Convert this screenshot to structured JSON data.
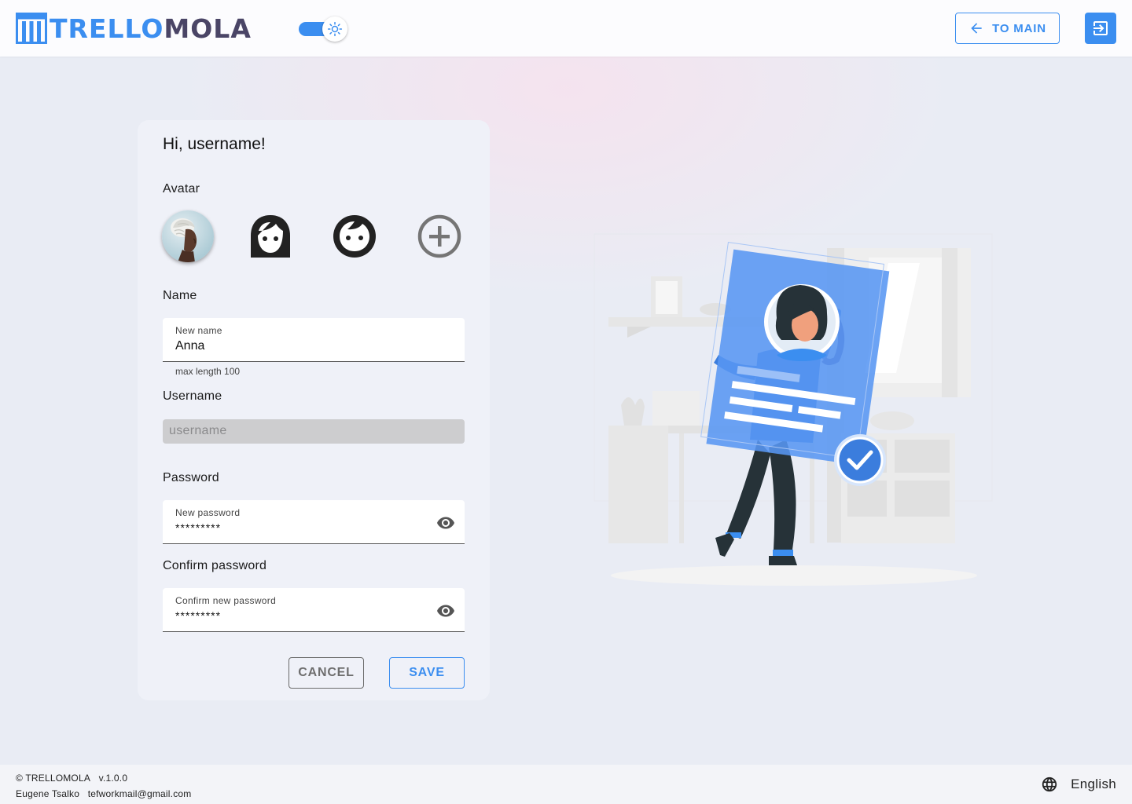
{
  "header": {
    "logo_text_blue": "TRELLO",
    "logo_text_dark": "MOLA",
    "to_main_label": "TO MAIN",
    "theme_icon": "sun-icon",
    "logout_icon": "logout-icon"
  },
  "profile": {
    "greeting": "Hi, username!",
    "avatar_label": "Avatar",
    "avatars": [
      "photo-avatar",
      "female-face-icon",
      "male-face-icon",
      "add-circle-icon"
    ],
    "name_label": "Name",
    "name_field": {
      "label": "New name",
      "value": "Anna",
      "helper": "max length 100"
    },
    "username_label": "Username",
    "username_field": {
      "placeholder": "username"
    },
    "password_label": "Password",
    "password_field": {
      "label": "New password",
      "value": "*********"
    },
    "confirm_label": "Confirm password",
    "confirm_field": {
      "label": "Confirm new password",
      "value": "*********"
    },
    "cancel_label": "CANCEL",
    "save_label": "SAVE"
  },
  "footer": {
    "copyright": "© TRELLOMOLA",
    "version": "v.1.0.0",
    "author": "Eugene Tsalko",
    "email": "tefworkmail@gmail.com",
    "language": "English"
  },
  "colors": {
    "accent": "#3b8ef0",
    "background": "#e9ecf4",
    "card": "#eff1f8"
  }
}
